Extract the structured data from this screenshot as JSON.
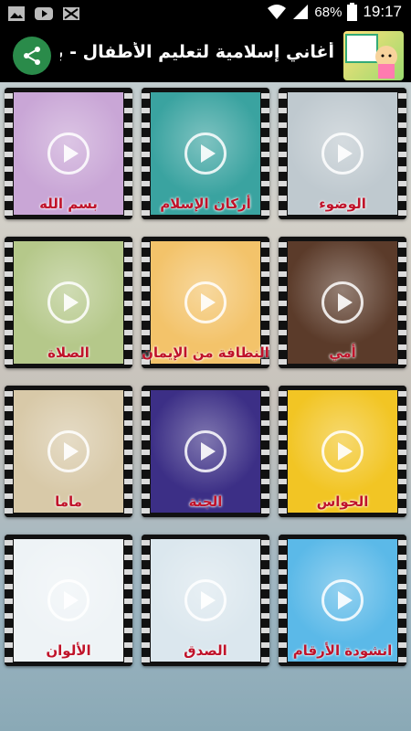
{
  "status_bar": {
    "battery": "68%",
    "time": "19:17",
    "icons": [
      "image-icon",
      "youtube-icon",
      "mail-icon",
      "wifi-icon",
      "signal-icon",
      "battery-icon"
    ]
  },
  "app_bar": {
    "title": "أغاني إسلامية لتعليم الأطفال - بدو",
    "share_icon": "share-icon"
  },
  "tiles": [
    {
      "caption": "بسم الله",
      "bg": "#c9a6d6"
    },
    {
      "caption": "أركان الإسلام",
      "bg": "#3aa3a0"
    },
    {
      "caption": "الوضوء",
      "bg": "#bfc9cf"
    },
    {
      "caption": "الصلاة",
      "bg": "#b5c88a"
    },
    {
      "caption": "النظافة من الإيمان",
      "bg": "#f3c36a"
    },
    {
      "caption": "أمي",
      "bg": "#5b3b2a"
    },
    {
      "caption": "ماما",
      "bg": "#d8c9a8"
    },
    {
      "caption": "الجنة",
      "bg": "#3c2f86"
    },
    {
      "caption": "الحواس",
      "bg": "#f2c524"
    },
    {
      "caption": "الألوان",
      "bg": "#eef3f6"
    },
    {
      "caption": "الصدق",
      "bg": "#dbe7ee"
    },
    {
      "caption": "انشودة الأرقام",
      "bg": "#5bb9e8"
    }
  ]
}
